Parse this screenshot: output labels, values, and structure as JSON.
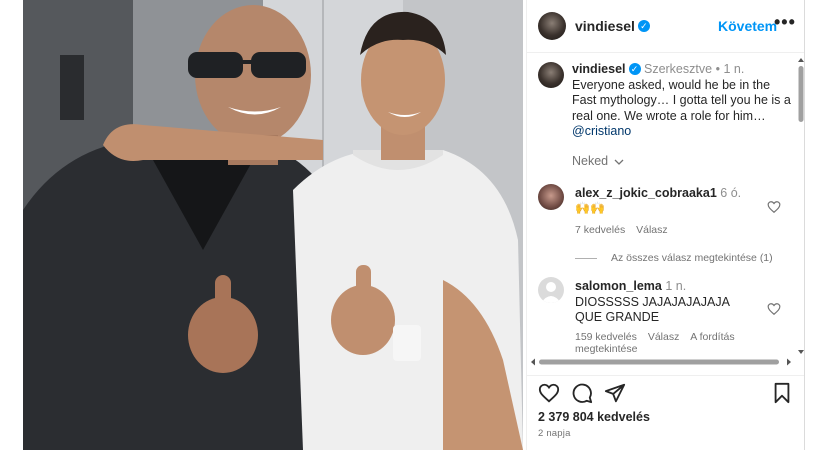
{
  "post": {
    "author": "vindiesel",
    "follow_label": "Követem",
    "more_label": "•••",
    "verified_mark": "✓",
    "caption": {
      "user": "vindiesel",
      "edited": "Szerkesztve",
      "dot": "•",
      "time": "1 n.",
      "text": "Everyone asked, would he be in the Fast mythology… I gotta tell you he is a real one.  We wrote a role for him…",
      "mention": "@cristiano"
    },
    "translate_label": "Neked",
    "comments": [
      {
        "user": "alex_z_jokic_cobraaka1",
        "time": "6 ó.",
        "text": "🙌🙌",
        "likes": "7 kedvelés",
        "reply": "Válasz",
        "view_replies": "Az összes válasz megtekintése (1)"
      },
      {
        "user": "salomon_lema",
        "time": "1 n.",
        "text": "DIOSSSSS JAJAJAJAJAJA QUE GRANDE",
        "likes": "159 kedvelés",
        "reply": "Válasz",
        "translation": "A fordítás megtekintése"
      }
    ],
    "likes_count": "2 379 804 kedvelés",
    "posted_ago": "2 napja"
  },
  "icons": {
    "like": "heart-icon",
    "comment": "comment-icon",
    "share": "paper-plane-icon",
    "save": "bookmark-icon"
  },
  "colors": {
    "accent": "#0095f6",
    "text": "#262626",
    "muted": "#737373",
    "link": "#00376b"
  }
}
